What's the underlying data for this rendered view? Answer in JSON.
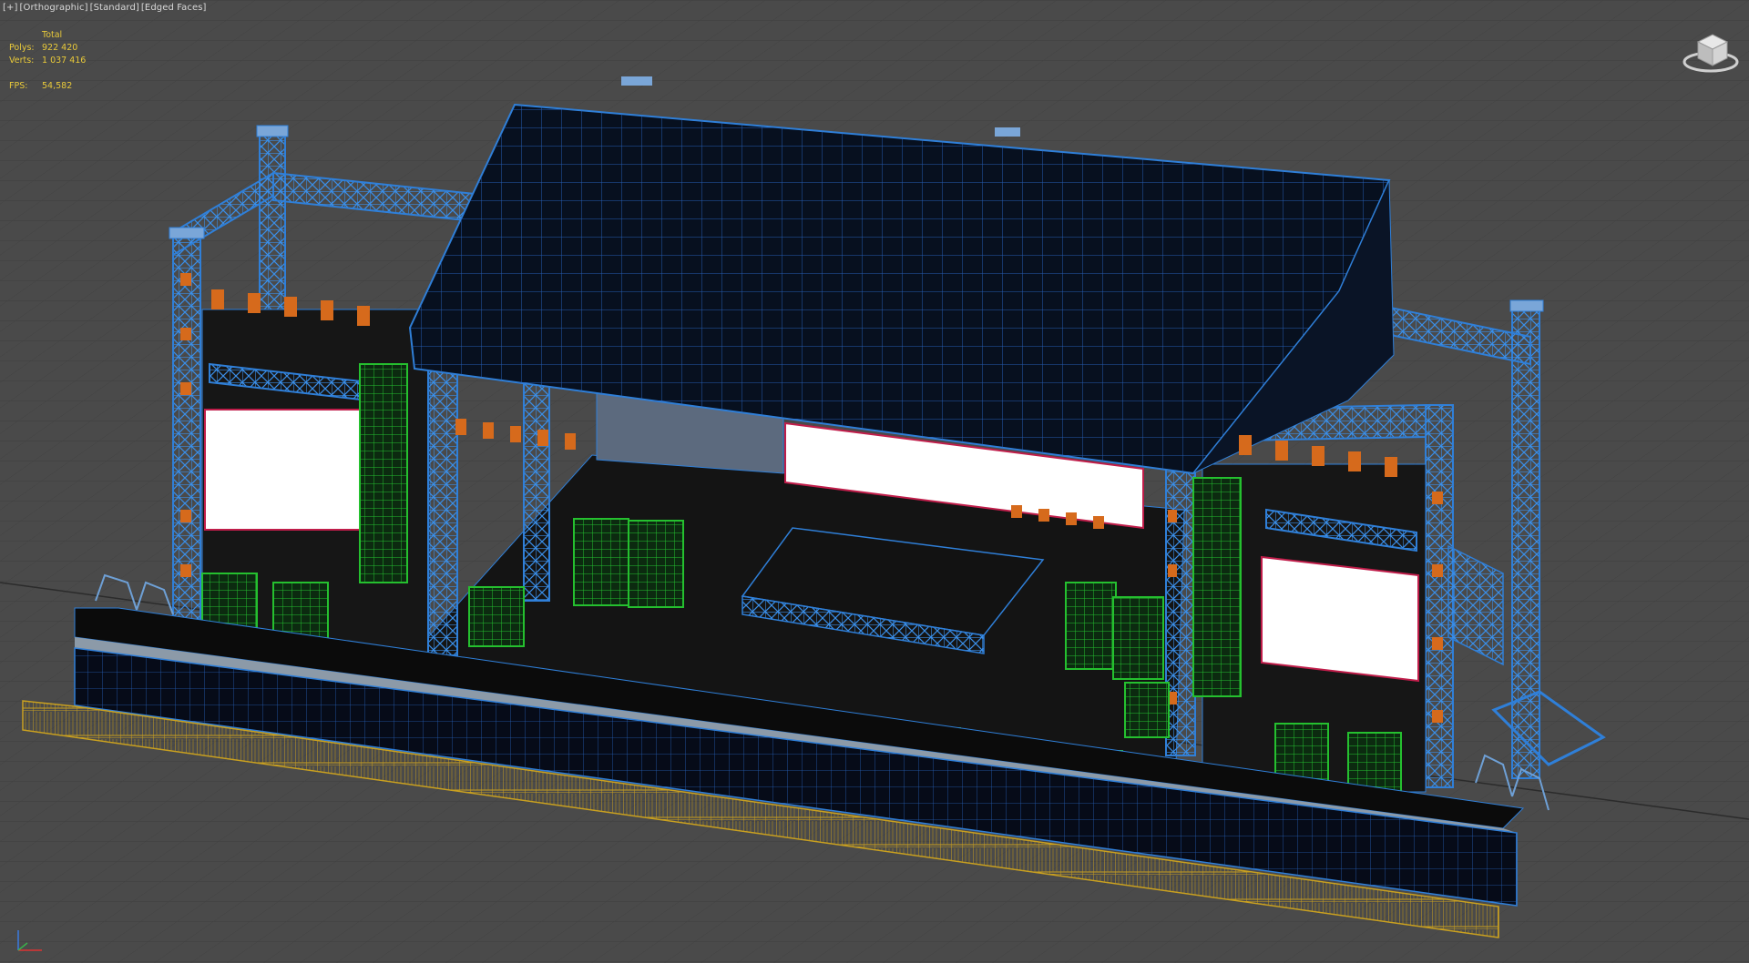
{
  "viewport": {
    "labels": [
      "[+]",
      "[Orthographic]",
      "[Standard]",
      "[Edged Faces]"
    ],
    "stats": {
      "header": "Total",
      "polys_label": "Polys:",
      "polys_value": "922 420",
      "verts_label": "Verts:",
      "verts_value": "1 037 416",
      "fps_label": "FPS:",
      "fps_value": "54,582"
    },
    "icons": {
      "viewcube": "viewcube-icon",
      "axis": "axis-tripod-icon"
    },
    "colors": {
      "background": "#4a4a4a",
      "grid": "#3b3b3b",
      "truss": "#2f7fd8",
      "roof": "#07101f",
      "speakers": "#1fae2a",
      "lights": "#d66a1c",
      "barrier": "#c9a020",
      "screen": "#ffffff",
      "stat_text": "#e8c93a"
    }
  }
}
